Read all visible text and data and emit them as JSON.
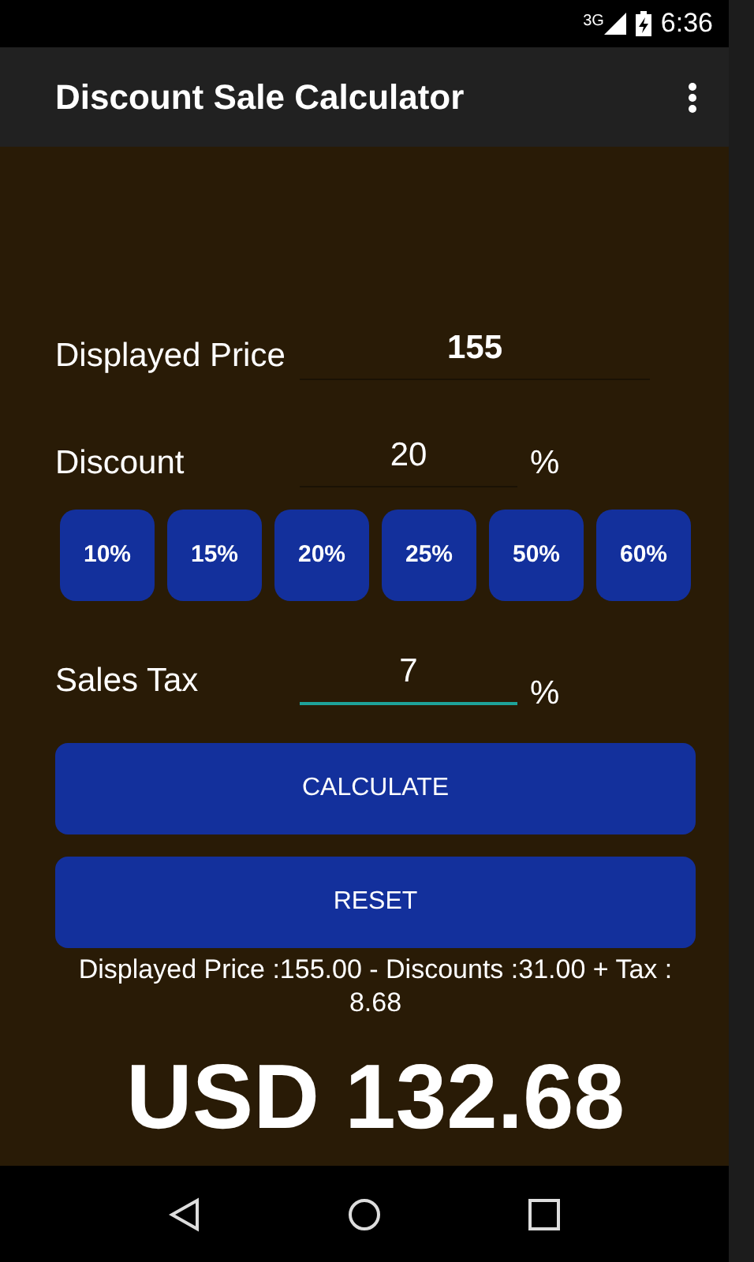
{
  "status_bar": {
    "network": "3G",
    "time": "6:36"
  },
  "app_bar": {
    "title": "Discount Sale Calculator"
  },
  "fields": [
    {
      "label": "Displayed Price",
      "value": "155",
      "bold": true,
      "focused": false
    },
    {
      "label": "Discount",
      "value": "20",
      "suffix": "%",
      "bold": false,
      "focused": false
    },
    {
      "label": "Sales Tax",
      "value": "7",
      "suffix": "%",
      "bold": false,
      "focused": true
    }
  ],
  "discount_buttons": [
    "10%",
    "15%",
    "20%",
    "25%",
    "50%",
    "60%"
  ],
  "buttons": [
    "CALCULATE",
    "RESET"
  ],
  "summary": "Displayed Price :155.00 - Discounts :31.00 + Tax : 8.68",
  "total": "USD 132.68"
}
